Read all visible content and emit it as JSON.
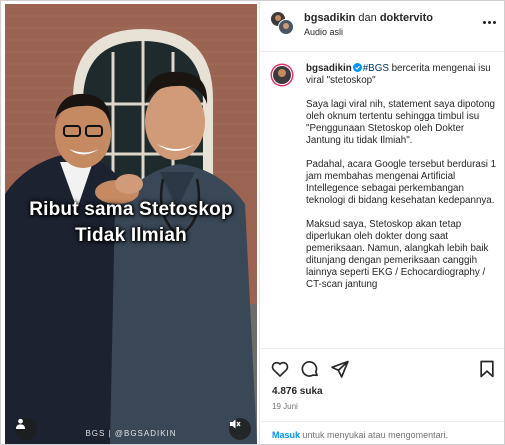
{
  "media": {
    "overlay_line1": "Ribut sama Stetoskop",
    "overlay_line2": "Tidak Ilmiah",
    "watermark": "BGS | @BGSADIKIN"
  },
  "header": {
    "user1": "bgsadikin",
    "connector": " dan ",
    "user2": "doktervito",
    "audio": "Audio asli"
  },
  "caption": {
    "username": "bgsadikin",
    "hashtag": "#BGS",
    "intro": " bercerita mengenai isu viral \"stetoskop\"",
    "paragraphs": [
      "Saya lagi viral nih, statement saya dipotong oleh oknum tertentu sehingga timbul isu \"Penggunaan Stetoskop oleh Dokter Jantung itu tidak Ilmiah\".",
      "Padahal, acara Google tersebut berdurasi 1 jam membahas mengenai Artificial Intellegence sebagai perkembangan teknologi di bidang kesehatan kedepannya.",
      "Maksud saya, Stetoskop akan tetap diperlukan oleh dokter dong saat pemeriksaan. Namun, alangkah lebih baik ditunjang dengan pemeriksaan canggih lainnya seperti EKG / Echocardiography / CT-scan jantung"
    ]
  },
  "stats": {
    "likes": "4.876 suka",
    "date": "19 Juni"
  },
  "footer": {
    "login": "Masuk",
    "rest": " untuk menyukai atau mengomentari."
  },
  "colors": {
    "link": "#00376b",
    "login": "#0095f6",
    "verified": "#0095f6"
  },
  "icons": [
    "heart-icon",
    "comment-icon",
    "share-icon",
    "bookmark-icon",
    "more-icon",
    "user-tag-icon",
    "mute-icon",
    "verified-icon"
  ]
}
